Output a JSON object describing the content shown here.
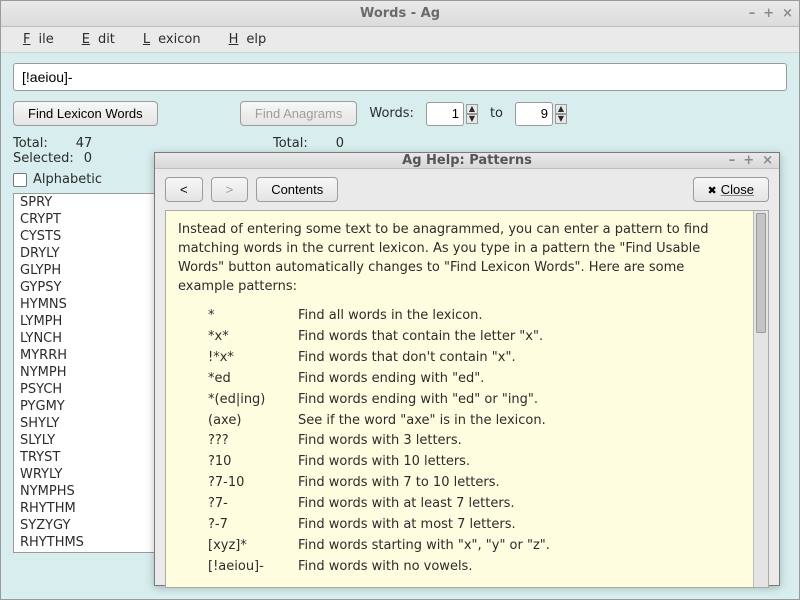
{
  "window": {
    "title": "Words - Ag",
    "menu": [
      "File",
      "Edit",
      "Lexicon",
      "Help"
    ]
  },
  "search": {
    "value": "[!aeiou]-"
  },
  "buttons": {
    "find_lexicon": "Find Lexicon Words",
    "find_anagrams": "Find Anagrams"
  },
  "words_range": {
    "label": "Words:",
    "from": "1",
    "to_label": "to",
    "to": "9"
  },
  "left_stats": {
    "total_label": "Total:",
    "total": "47",
    "selected_label": "Selected:",
    "selected": "0"
  },
  "right_stats": {
    "total_label": "Total:",
    "total": "0"
  },
  "alphabetic_label": "Alphabetic",
  "word_list": [
    "SPRY",
    "CRYPT",
    "CYSTS",
    "DRYLY",
    "GLYPH",
    "GYPSY",
    "HYMNS",
    "LYMPH",
    "LYNCH",
    "MYRRH",
    "NYMPH",
    "PSYCH",
    "PYGMY",
    "SHYLY",
    "SLYLY",
    "TRYST",
    "WRYLY",
    "NYMPHS",
    "RHYTHM",
    "SYZYGY",
    "RHYTHMS"
  ],
  "help": {
    "title": "Ag Help: Patterns",
    "nav_back": "<",
    "nav_fwd": ">",
    "contents": "Contents",
    "close": "Close",
    "intro": "Instead of entering some text to be anagrammed, you can enter a pattern to find matching words in the current lexicon. As you type in a pattern the \"Find Usable Words\" button automatically changes to \"Find Lexicon Words\". Here are some example patterns:",
    "patterns": [
      {
        "p": "*",
        "d": "Find all words in the lexicon."
      },
      {
        "p": "*x*",
        "d": "Find words that contain the letter \"x\"."
      },
      {
        "p": "!*x*",
        "d": "Find words that don't contain \"x\"."
      },
      {
        "p": "*ed",
        "d": "Find words ending with \"ed\"."
      },
      {
        "p": "*(ed|ing)",
        "d": "Find words ending with \"ed\" or \"ing\"."
      },
      {
        "p": "(axe)",
        "d": "See if the word \"axe\" is in the lexicon."
      },
      {
        "p": "???",
        "d": "Find words with 3 letters."
      },
      {
        "p": "?10",
        "d": "Find words with 10 letters."
      },
      {
        "p": "?7-10",
        "d": "Find words with 7 to 10 letters."
      },
      {
        "p": "?7-",
        "d": "Find words with at least 7 letters."
      },
      {
        "p": "?-7",
        "d": "Find words with at most 7 letters."
      },
      {
        "p": "[xyz]*",
        "d": "Find words starting with \"x\", \"y\" or \"z\"."
      },
      {
        "p": "[!aeiou]-",
        "d": "Find words with no vowels."
      }
    ]
  }
}
